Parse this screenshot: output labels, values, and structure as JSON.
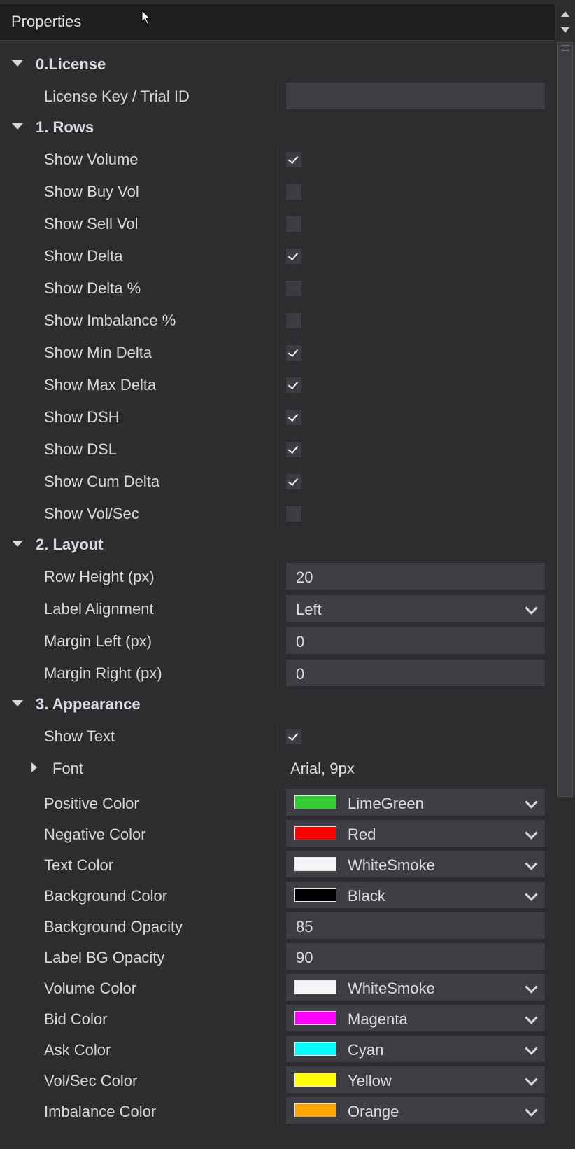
{
  "panel": {
    "title": "Properties"
  },
  "categories": {
    "license": "0.License",
    "rows": "1. Rows",
    "layout": "2. Layout",
    "appearance": "3. Appearance"
  },
  "license": {
    "key_label": "License Key / Trial ID",
    "key_value": ""
  },
  "rows": [
    {
      "label": "Show Volume",
      "checked": true
    },
    {
      "label": "Show Buy Vol",
      "checked": false
    },
    {
      "label": "Show Sell Vol",
      "checked": false
    },
    {
      "label": "Show Delta",
      "checked": true
    },
    {
      "label": "Show Delta %",
      "checked": false
    },
    {
      "label": "Show Imbalance %",
      "checked": false
    },
    {
      "label": "Show Min Delta",
      "checked": true
    },
    {
      "label": "Show Max Delta",
      "checked": true
    },
    {
      "label": "Show DSH",
      "checked": true
    },
    {
      "label": "Show DSL",
      "checked": true
    },
    {
      "label": "Show Cum Delta",
      "checked": true
    },
    {
      "label": "Show Vol/Sec",
      "checked": false
    }
  ],
  "layout": {
    "row_height_label": "Row Height (px)",
    "row_height_value": "20",
    "label_alignment_label": "Label Alignment",
    "label_alignment_value": "Left",
    "margin_left_label": "Margin Left (px)",
    "margin_left_value": "0",
    "margin_right_label": "Margin Right (px)",
    "margin_right_value": "0"
  },
  "appearance": {
    "show_text_label": "Show Text",
    "show_text_checked": true,
    "font_label": "Font",
    "font_value": "Arial, 9px",
    "positive_color_label": "Positive Color",
    "positive_color_value": "LimeGreen",
    "positive_color_hex": "#32cd32",
    "negative_color_label": "Negative Color",
    "negative_color_value": "Red",
    "negative_color_hex": "#ff0000",
    "text_color_label": "Text Color",
    "text_color_value": "WhiteSmoke",
    "text_color_hex": "#f5f5f5",
    "background_color_label": "Background Color",
    "background_color_value": "Black",
    "background_color_hex": "#000000",
    "background_opacity_label": "Background Opacity",
    "background_opacity_value": "85",
    "label_bg_opacity_label": "Label BG Opacity",
    "label_bg_opacity_value": "90",
    "volume_color_label": "Volume Color",
    "volume_color_value": "WhiteSmoke",
    "volume_color_hex": "#f5f5f5",
    "bid_color_label": "Bid Color",
    "bid_color_value": "Magenta",
    "bid_color_hex": "#ff00ff",
    "ask_color_label": "Ask Color",
    "ask_color_value": "Cyan",
    "ask_color_hex": "#00ffff",
    "vol_sec_color_label": "Vol/Sec Color",
    "vol_sec_color_value": "Yellow",
    "vol_sec_color_hex": "#ffff00",
    "imbalance_color_label": "Imbalance Color",
    "imbalance_color_value": "Orange",
    "imbalance_color_hex": "#ffa500"
  },
  "icons": {
    "collapse": "caret-down-icon",
    "expand": "caret-right-icon",
    "dropdown": "chevron-down-icon",
    "check": "check-icon",
    "scroll_up": "scroll-up-icon",
    "scroll_down": "scroll-down-icon",
    "cursor": "mouse-cursor-icon"
  }
}
